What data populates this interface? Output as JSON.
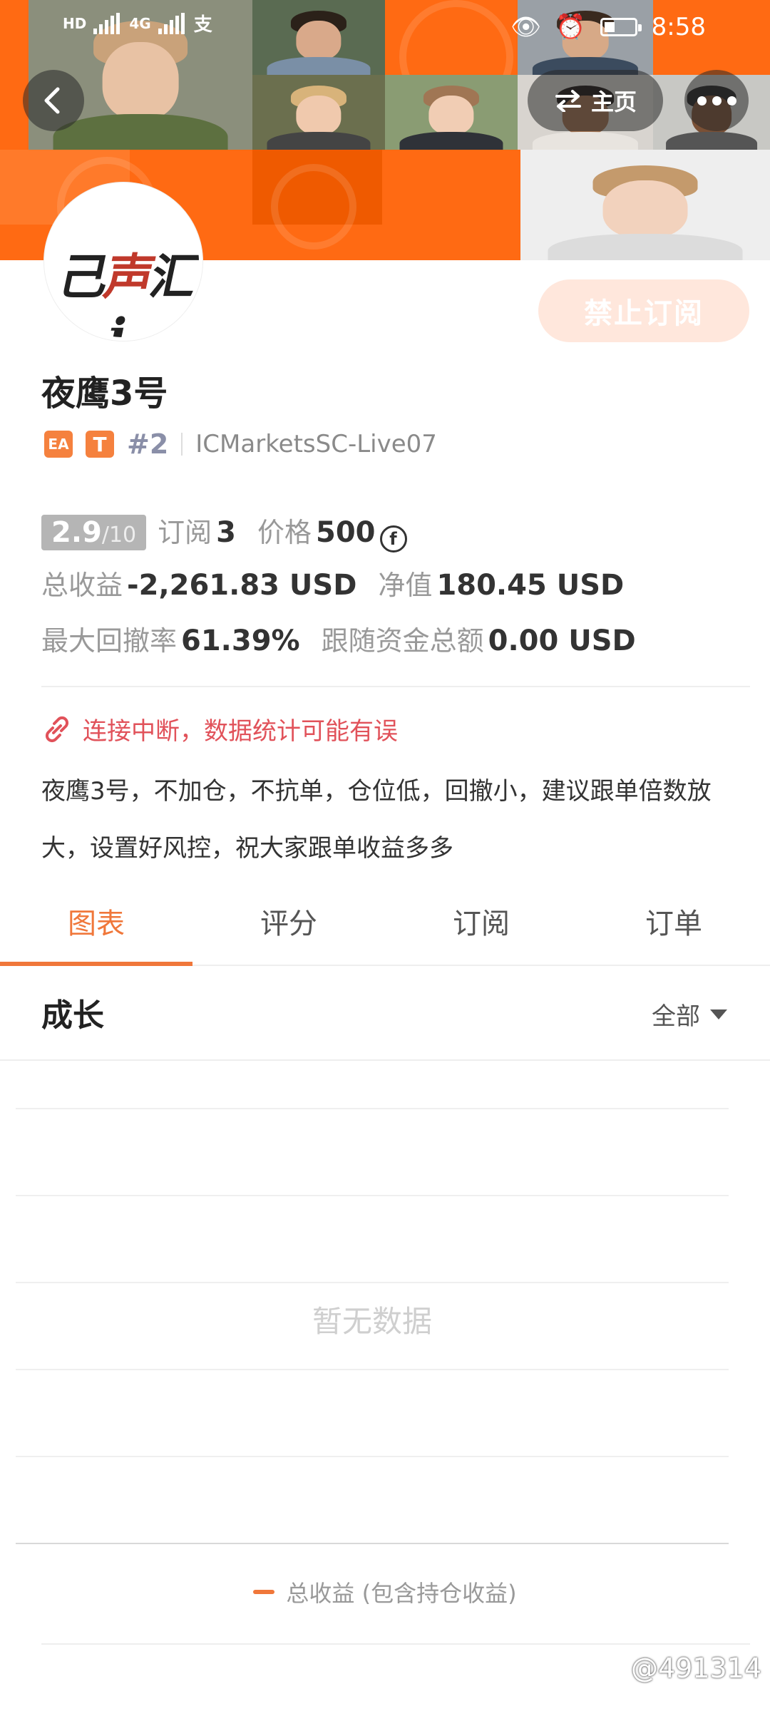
{
  "status_bar": {
    "network_left": "HD",
    "network_right": "4G",
    "pay_icon": "alipay-icon",
    "time": "8:58"
  },
  "header": {
    "back_icon": "back-arrow-icon",
    "home_label": "主页",
    "home_icon": "swap-icon",
    "more_icon": "more-dots-icon"
  },
  "banner": {
    "accent": "#ff6a13"
  },
  "avatar": {
    "logo_left": "己",
    "logo_mid": "声",
    "logo_right": "汇",
    "logo_tail": "i"
  },
  "profile": {
    "disable_button": "禁止订阅",
    "name": "夜鹰3号",
    "badge_ea": "EA",
    "badge_t": "T",
    "rank": "#2",
    "server": "ICMarketsSC-Live07"
  },
  "stats": {
    "rating_main": "2.9",
    "rating_max": "/10",
    "subscribe_label": "订阅",
    "subscribe_count": "3",
    "price_label": "价格",
    "price_value": "500",
    "coin_symbol": "f",
    "total_profit_label": "总收益",
    "total_profit_value": "-2,261.83 USD",
    "net_value_label": "净值",
    "net_value_value": "180.45 USD",
    "max_drawdown_label": "最大回撤率",
    "max_drawdown_value": "61.39%",
    "follow_funds_label": "跟随资金总额",
    "follow_funds_value": "0.00 USD"
  },
  "warning": {
    "icon": "broken-link-icon",
    "text": "连接中断，数据统计可能有误"
  },
  "description": "夜鹰3号，不加仓，不抗单，仓位低，回撤小，建议跟单倍数放大，设置好风控，祝大家跟单收益多多",
  "tabs": [
    {
      "label": "图表",
      "active": true
    },
    {
      "label": "评分",
      "active": false
    },
    {
      "label": "订阅",
      "active": false
    },
    {
      "label": "订单",
      "active": false
    }
  ],
  "section": {
    "title": "成长",
    "filter_label": "全部",
    "empty_text": "暂无数据",
    "legend_label": "总收益 (包含持仓收益)",
    "legend_color": "#f0773a"
  },
  "watermark": "@491314"
}
